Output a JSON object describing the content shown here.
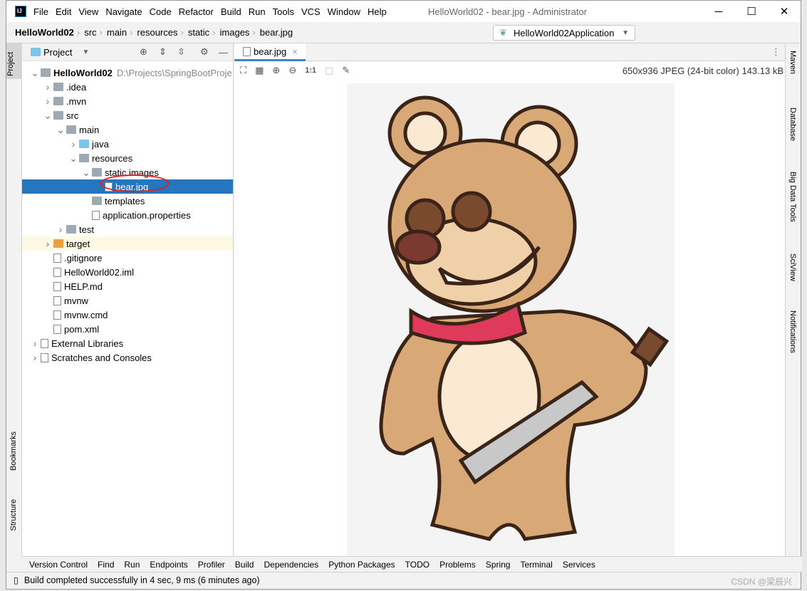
{
  "window": {
    "title": "HelloWorld02 - bear.jpg - Administrator",
    "logo": "IJ"
  },
  "menu": [
    "File",
    "Edit",
    "View",
    "Navigate",
    "Code",
    "Refactor",
    "Build",
    "Run",
    "Tools",
    "VCS",
    "Window",
    "Help"
  ],
  "breadcrumb": [
    "HelloWorld02",
    "src",
    "main",
    "resources",
    "static",
    "images",
    "bear.jpg"
  ],
  "run_config": "HelloWorld02Application",
  "project_panel": {
    "title": "Project",
    "tree": [
      {
        "label": "HelloWorld02",
        "extra": "D:\\Projects\\SpringBootProje",
        "level": 0,
        "arrow": "v",
        "icon": "module-folder"
      },
      {
        "label": ".idea",
        "level": 1,
        "arrow": ">",
        "icon": "folder"
      },
      {
        "label": ".mvn",
        "level": 1,
        "arrow": ">",
        "icon": "folder"
      },
      {
        "label": "src",
        "level": 1,
        "arrow": "v",
        "icon": "folder"
      },
      {
        "label": "main",
        "level": 2,
        "arrow": "v",
        "icon": "folder"
      },
      {
        "label": "java",
        "level": 3,
        "arrow": ">",
        "icon": "source-folder"
      },
      {
        "label": "resources",
        "level": 3,
        "arrow": "v",
        "icon": "folder"
      },
      {
        "label": "static.images",
        "level": 4,
        "arrow": "v",
        "icon": "folder"
      },
      {
        "label": "bear.jpg",
        "level": 5,
        "arrow": "",
        "icon": "image-file",
        "selected": true
      },
      {
        "label": "templates",
        "level": 4,
        "arrow": "",
        "icon": "folder"
      },
      {
        "label": "application.properties",
        "level": 4,
        "arrow": "",
        "icon": "properties-file"
      },
      {
        "label": "test",
        "level": 2,
        "arrow": ">",
        "icon": "folder"
      },
      {
        "label": "target",
        "level": 1,
        "arrow": ">",
        "icon": "excluded-folder",
        "highlight": true
      },
      {
        "label": ".gitignore",
        "level": 1,
        "arrow": "",
        "icon": "file"
      },
      {
        "label": "HelloWorld02.iml",
        "level": 1,
        "arrow": "",
        "icon": "file"
      },
      {
        "label": "HELP.md",
        "level": 1,
        "arrow": "",
        "icon": "md-file"
      },
      {
        "label": "mvnw",
        "level": 1,
        "arrow": "",
        "icon": "file"
      },
      {
        "label": "mvnw.cmd",
        "level": 1,
        "arrow": "",
        "icon": "file"
      },
      {
        "label": "pom.xml",
        "level": 1,
        "arrow": "",
        "icon": "maven-file"
      },
      {
        "label": "External Libraries",
        "level": 0,
        "arrow": ">",
        "icon": "libraries"
      },
      {
        "label": "Scratches and Consoles",
        "level": 0,
        "arrow": ">",
        "icon": "scratches"
      }
    ]
  },
  "editor": {
    "tab": "bear.jpg",
    "image_info": "650x936 JPEG (24-bit color) 143.13 kB",
    "zoom_actual": "1:1"
  },
  "left_strip": [
    "Project",
    "Bookmarks",
    "Structure"
  ],
  "right_strip": [
    "Maven",
    "Database",
    "Big Data Tools",
    "SciView",
    "Notifications"
  ],
  "bottom_tools": [
    "Version Control",
    "Find",
    "Run",
    "Endpoints",
    "Profiler",
    "Build",
    "Dependencies",
    "Python Packages",
    "TODO",
    "Problems",
    "Spring",
    "Terminal",
    "Services"
  ],
  "status": "Build completed successfully in 4 sec, 9 ms (6 minutes ago)",
  "watermark": "CSDN @梁辰兴",
  "colors": {
    "selection": "#2675bf",
    "annotation_circle": "#e02020",
    "stop": "#db5860",
    "run_green": "#59a869"
  }
}
